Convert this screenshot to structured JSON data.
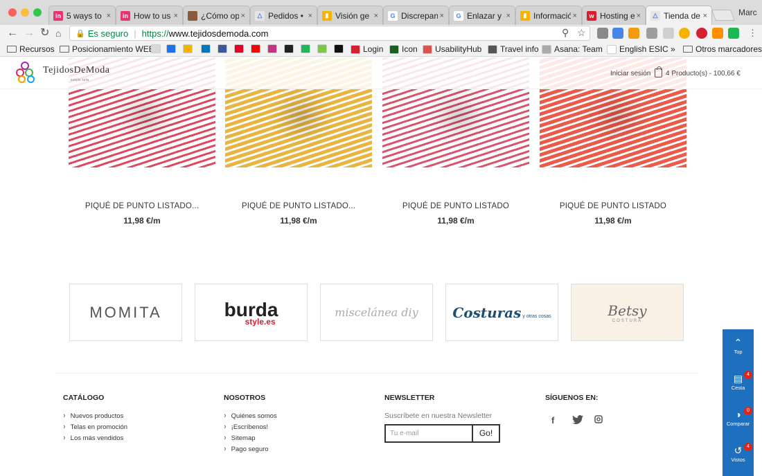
{
  "browser": {
    "tabs": [
      {
        "title": "5 ways to",
        "fav_color": "#e8336f",
        "fav_char": "in"
      },
      {
        "title": "How to us",
        "fav_color": "#e8336f",
        "fav_char": "in"
      },
      {
        "title": "¿Cómo op",
        "fav_color": "#8a5a3c",
        "fav_char": ""
      },
      {
        "title": "Pedidos •",
        "fav_color": "#e5e5e5",
        "fav_char": "△"
      },
      {
        "title": "Visión ge",
        "fav_color": "#f4b400",
        "fav_char": "▮"
      },
      {
        "title": "Discrepan",
        "fav_color": "#ffffff",
        "fav_char": "G"
      },
      {
        "title": "Enlazar y c",
        "fav_color": "#ffffff",
        "fav_char": "G"
      },
      {
        "title": "Informació",
        "fav_color": "#f4b400",
        "fav_char": "▮"
      },
      {
        "title": "Hosting e",
        "fav_color": "#d6202f",
        "fav_char": "w"
      },
      {
        "title": "Tienda de",
        "fav_color": "#e5e5e5",
        "fav_char": "△"
      }
    ],
    "tab_close": "×",
    "profile": "Marc",
    "address": {
      "secure_label": "Es seguro",
      "url_protocol": "https://",
      "url_host": "www.tejidosdemoda.com"
    },
    "bookmarks": [
      {
        "label": "Recursos",
        "type": "folder"
      },
      {
        "label": "Posicionamiento WEB",
        "type": "folder"
      },
      {
        "label": "",
        "type": "icon",
        "color": "#d9d9d9"
      },
      {
        "label": "",
        "type": "icon",
        "color": "#1a73e8"
      },
      {
        "label": "",
        "type": "icon",
        "color": "#f4b400"
      },
      {
        "label": "",
        "type": "icon",
        "color": "#0079bf"
      },
      {
        "label": "",
        "type": "icon",
        "color": "#3b5998"
      },
      {
        "label": "",
        "type": "icon",
        "color": "#e60023"
      },
      {
        "label": "",
        "type": "icon",
        "color": "#ff0000"
      },
      {
        "label": "",
        "type": "icon",
        "color": "#c13584"
      },
      {
        "label": "",
        "type": "icon",
        "color": "#222222"
      },
      {
        "label": "",
        "type": "icon",
        "color": "#1db954"
      },
      {
        "label": "",
        "type": "icon",
        "color": "#7ac943"
      },
      {
        "label": "",
        "type": "icon",
        "color": "#111111"
      },
      {
        "label": "Login",
        "type": "link",
        "color": "#d6202f"
      },
      {
        "label": "Icon",
        "type": "link",
        "color": "#1b5e20"
      },
      {
        "label": "UsabilityHub",
        "type": "link",
        "color": "#d9534f"
      },
      {
        "label": "Travel info",
        "type": "link",
        "color": "#555555"
      },
      {
        "label": "Asana: Team",
        "type": "link",
        "color": "#aaaaaa"
      },
      {
        "label": "English ESIC",
        "type": "link",
        "color": "#ffffff"
      }
    ],
    "bookmarks_overflow": "»",
    "other_bookmarks": "Otros marcadores"
  },
  "site": {
    "logo": {
      "name": "TejidosDeModa",
      "tagline": "estilo tela"
    },
    "login_label": "Iniciar sesión",
    "cart_label": "4 Producto(s) - 100,66 €"
  },
  "products": [
    {
      "name": "PIQUÉ DE PUNTO LISTADO...",
      "price": "11,98 €/m",
      "stripe": "#e0485f",
      "base": "#ffffff"
    },
    {
      "name": "PIQUÉ DE PUNTO LISTADO...",
      "price": "11,98 €/m",
      "stripe": "#ffffff",
      "base": "#e8b640"
    },
    {
      "name": "PIQUÉ DE PUNTO LISTADO",
      "price": "11,98 €/m",
      "stripe": "#d9546b",
      "base": "#ffffff"
    },
    {
      "name": "PIQUÉ DE PUNTO LISTADO",
      "price": "11,98 €/m",
      "stripe": "#ffffff",
      "base": "#ec5a4a"
    }
  ],
  "brands": [
    {
      "name": "MOMITA"
    },
    {
      "name": "burda",
      "sub": "style.es"
    },
    {
      "name": "miscelánea diy"
    },
    {
      "name": "Costuras",
      "sub": "y otras cosas"
    },
    {
      "name": "Betsy",
      "sub": "COSTURA"
    }
  ],
  "footer": {
    "catalog": {
      "title": "CATÁLOGO",
      "items": [
        "Nuevos productos",
        "Telas en promoción",
        "Los más vendidos"
      ]
    },
    "about": {
      "title": "NOSOTROS",
      "items": [
        "Quiénes somos",
        "¡Escríbenos!",
        "Sitemap",
        "Pago seguro"
      ]
    },
    "newsletter": {
      "title": "NEWSLETTER",
      "text": "Suscríbete en nuestra Newsletter",
      "placeholder": "Tu e-mail",
      "button": "Go!"
    },
    "social": {
      "title": "SÍGUENOS EN:",
      "icons": [
        "facebook-icon",
        "twitter-icon",
        "instagram-icon"
      ]
    }
  },
  "sidebar": {
    "top": "Top",
    "cart": {
      "label": "Cesta",
      "count": "4"
    },
    "compare": {
      "label": "Comparar",
      "count": "0"
    },
    "viewed": {
      "label": "Vistos",
      "count": "4"
    }
  },
  "colors": {
    "sidebar": "#1f6fbf",
    "badge": "#e2231a",
    "secure": "#0b8043"
  }
}
